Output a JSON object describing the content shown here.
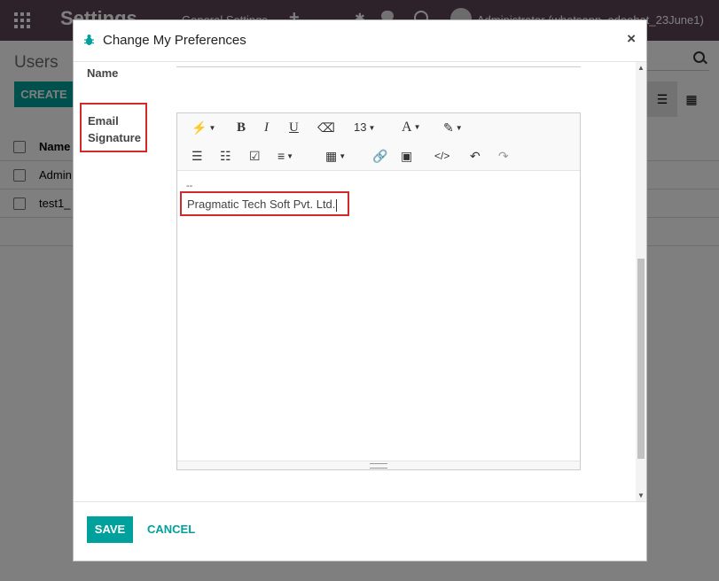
{
  "topbar": {
    "app_title": "Settings",
    "menu_general": "General Settings",
    "plus": "+",
    "user": "Administrator (whatsapp_odoobot_23June1)"
  },
  "control": {
    "breadcrumb": "Users",
    "create": "CREATE"
  },
  "list": {
    "header": "Name",
    "rows": [
      "Admin",
      "test1_"
    ]
  },
  "modal": {
    "title": "Change My Preferences",
    "close": "×",
    "name_label": "Name",
    "sig_label_line1": "Email",
    "sig_label_line2": "Signature",
    "toolbar": {
      "bold": "B",
      "italic": "I",
      "underline": "U",
      "font_size": "13",
      "font_color": "A"
    },
    "signature_dash": "--",
    "signature_text": "Pragmatic Tech Soft Pvt. Ltd.",
    "save": "SAVE",
    "cancel": "CANCEL"
  },
  "colors": {
    "brand": "#5b4452",
    "accent": "#00a09d",
    "highlight": "#d02b2b"
  }
}
